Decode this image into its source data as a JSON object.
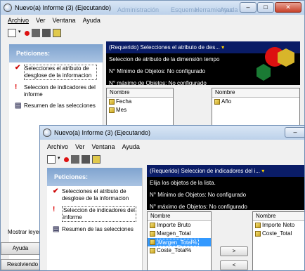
{
  "back_window": {
    "title": "Nuevo(a) Informe (3) (Ejecutando)",
    "menu": [
      "Archivo",
      "Ver",
      "Ventana",
      "Ayuda"
    ],
    "ghost_menu": [
      "Administración",
      "Esquema",
      "Herramientas",
      "Ayuda"
    ],
    "peticiones_header": "Peticiones:",
    "steps": [
      {
        "label": "Selecciones el atributo de desglose de la informacion"
      },
      {
        "label": "Seleccion de indicadores del informe"
      },
      {
        "label": "Resumen de las selecciones"
      }
    ],
    "banner": {
      "head": "(Requerido) Selecciones el atributo de des...",
      "line1": "Seleccion de atributo de la dimensión tempo",
      "min": "N° Mínimo de Objetos: No configurado",
      "max": "N° máximo de Objetos: No configurado"
    },
    "available_list": {
      "header": "Nombre",
      "items": [
        "Fecha",
        "Mes"
      ]
    },
    "selected_list": {
      "header": "Nombre",
      "items": [
        "Año"
      ]
    },
    "bottom": {
      "mostrar": "Mostrar leyen",
      "ayuda_button": "Ayuda",
      "resolviendo": "Resolviendo"
    }
  },
  "front_window": {
    "title": "Nuevo(a) Informe (3) (Ejecutando)",
    "menu": [
      "Archivo",
      "Ver",
      "Ventana",
      "Ayuda"
    ],
    "peticiones_header": "Peticiones:",
    "steps": [
      {
        "label": "Selecciones el atributo de desglose de la informacion"
      },
      {
        "label": "Seleccion de indicadores del informe"
      },
      {
        "label": "Resumen de las selecciones"
      }
    ],
    "banner": {
      "head": "(Requerido) Seleccion de indicadores del i...",
      "line1": "Elija los objetos de la lista.",
      "min": "N° Mínimo de Objetos: No configurado",
      "max": "N° máximo de Objetos: No configurado"
    },
    "available_list": {
      "header": "Nombre",
      "items": [
        "Importe Bruto",
        "Margen_Total",
        "Margen_Total%",
        "Coste_Total%"
      ],
      "selected_index": 2
    },
    "selected_list": {
      "header": "Nombre",
      "items": [
        "Importe Neto",
        "Coste_Total"
      ]
    },
    "add_button": ">",
    "remove_button": "<"
  },
  "colors": {
    "banner_head": "#0a1c66",
    "selection": "#3399ff"
  }
}
